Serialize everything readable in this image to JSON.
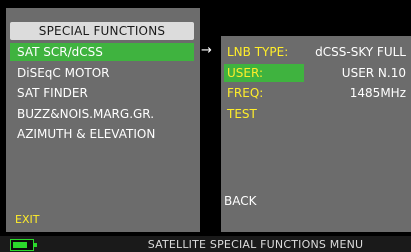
{
  "left_menu": {
    "title": "SPECIAL FUNCTIONS",
    "items": [
      {
        "label": "SAT SCR/dCSS",
        "selected": true
      },
      {
        "label": "DiSEqC MOTOR",
        "selected": false
      },
      {
        "label": "SAT FINDER",
        "selected": false
      },
      {
        "label": "BUZZ&NOIS.MARG.GR.",
        "selected": false
      },
      {
        "label": "AZIMUTH & ELEVATION",
        "selected": false
      }
    ],
    "exit_label": "EXIT"
  },
  "arrow_icon": "right-arrow-icon",
  "right_menu": {
    "rows": [
      {
        "label": "LNB TYPE:",
        "value": "dCSS-SKY FULL",
        "highlight": false
      },
      {
        "label": "USER:",
        "value": "USER N.10",
        "highlight": true
      },
      {
        "label": "FREQ:",
        "value": "1485MHz",
        "highlight": false
      },
      {
        "label": "TEST",
        "value": "",
        "highlight": false
      }
    ],
    "back_label": "BACK"
  },
  "footer": {
    "title": "SATELLITE SPECIAL FUNCTIONS MENU",
    "battery_icon": "battery-icon",
    "battery_level": 0.75
  },
  "colors": {
    "highlight_green": "#3fb33f",
    "label_yellow": "#ffee2a",
    "panel_gray": "#6c6c6c"
  }
}
